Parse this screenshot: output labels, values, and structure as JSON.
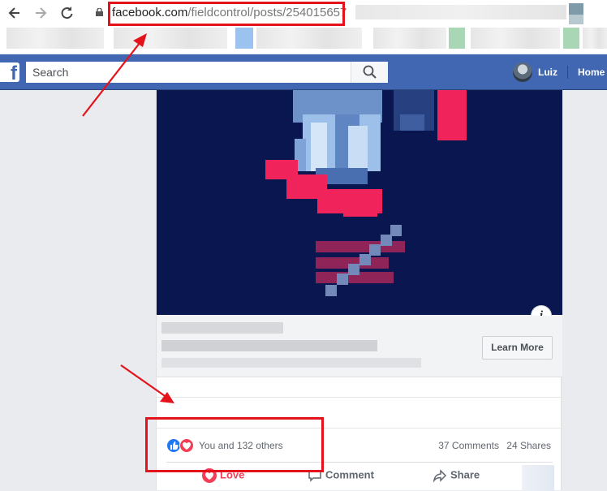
{
  "browser": {
    "url_domain": "facebook.com",
    "url_path": "/fieldcontrol/posts/254015657"
  },
  "fb_bar": {
    "logo": "f",
    "search_placeholder": "Search",
    "user_name": "Luiz",
    "home_label": "Home"
  },
  "ad": {
    "cta_label": "Learn More",
    "info_glyph": "i"
  },
  "post": {
    "reactions_text": "You and 132 others",
    "comments": "37 Comments",
    "shares": "24 Shares"
  },
  "actions": {
    "love": "Love",
    "comment": "Comment",
    "share": "Share"
  },
  "colors": {
    "annotation_red": "#e3121b",
    "fb_blue": "#4267b2",
    "love_red": "#f33e58"
  }
}
